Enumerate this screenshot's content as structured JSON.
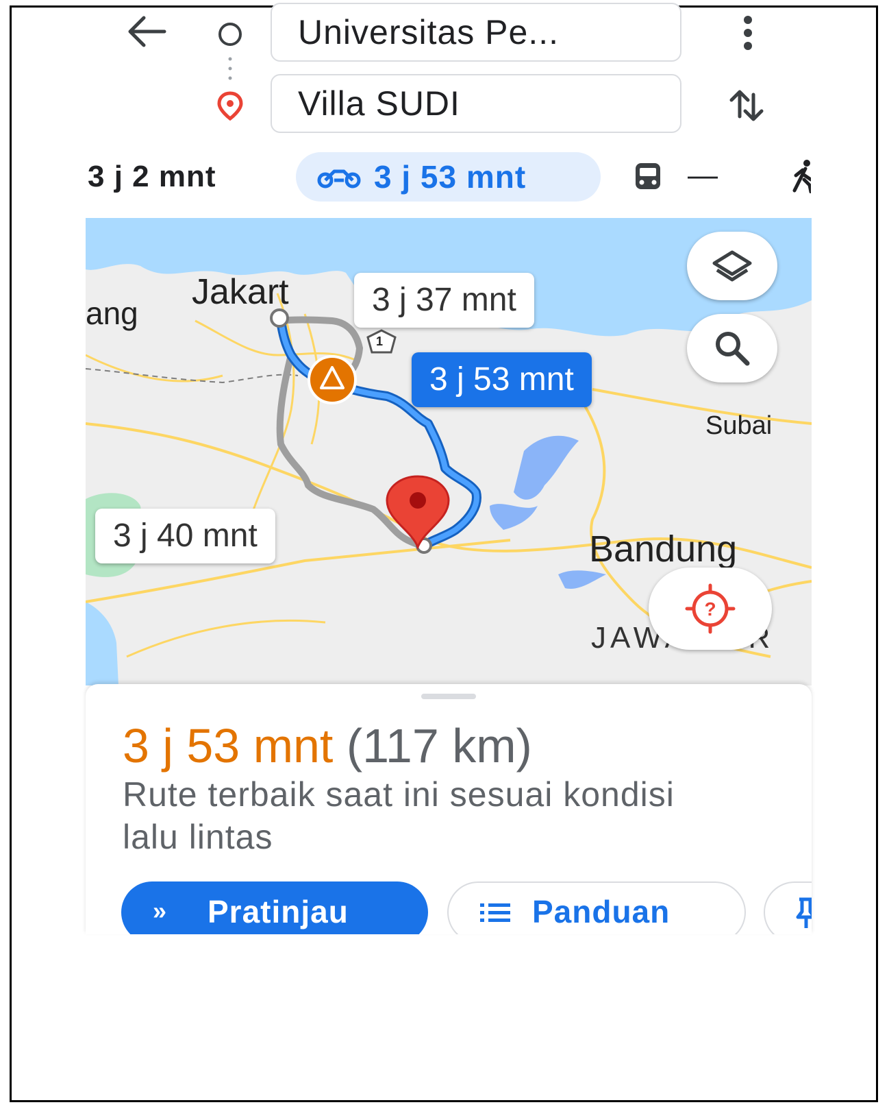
{
  "header": {
    "origin_value": "Universitas Pe...",
    "destination_value": "Villa SUDI"
  },
  "modes": {
    "drive_duration": "3 j 2 mnt",
    "motorcycle_duration": "3 j 53 mnt",
    "transit_duration": "—"
  },
  "map": {
    "labels": {
      "tangerang_fragment": "ang",
      "jakarta": "Jakart",
      "subang": "Subai",
      "bandung": "Bandung",
      "jawa_barat": "JAWA BAR",
      "road_shield": "1"
    },
    "route_callouts": {
      "alt1": "3 j 37 mnt",
      "selected": "3 j 53 mnt",
      "alt2": "3 j 40 mnt"
    },
    "colors": {
      "water": "#aadaff",
      "land": "#eeeeee",
      "road": "#fdd663",
      "route_selected": "#1a73e8",
      "route_alternate": "#9e9e9e",
      "destination_pin": "#ea4335",
      "incident": "#e37400"
    }
  },
  "sheet": {
    "duration": "3 j 53 mnt",
    "distance": "(117 km)",
    "description": "Rute terbaik saat ini sesuai kondisi lalu lintas",
    "preview_icon": "»",
    "preview_label": "Pratinjau",
    "steps_label": "Panduan"
  }
}
